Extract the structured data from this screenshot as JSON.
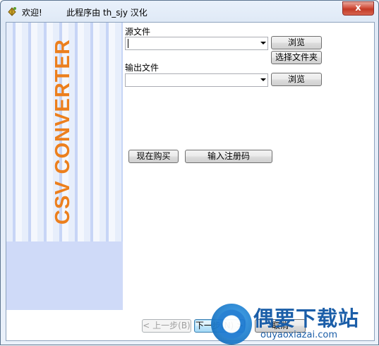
{
  "window": {
    "title": "欢迎!         此程序由 th_sjy 汉化",
    "close_label": "x"
  },
  "banner": {
    "text": "CSV CONVERTER"
  },
  "source": {
    "label": "源文件",
    "value": "",
    "browse_label": "浏览",
    "select_folder_label": "选择文件夹"
  },
  "output": {
    "label": "输出文件",
    "value": "",
    "browse_label": "浏览"
  },
  "actions": {
    "buy_now_label": "现在购买",
    "register_label": "输入注册码"
  },
  "nav": {
    "back_label": "< 上一步(B)",
    "next_label": "下一步(N) >",
    "cancel_label": "取消"
  },
  "watermark": {
    "text": "偶要下载站",
    "url": "ouyaoxiazai.com"
  },
  "colors": {
    "banner_text": "#ec7f1d",
    "banner_bg": "#cfdaf8",
    "watermark": "#1b5ea8"
  }
}
